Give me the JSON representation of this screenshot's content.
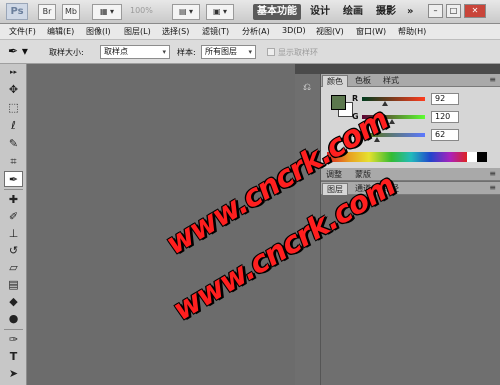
{
  "titlebar": {
    "logo": "Ps",
    "br_label": "Br",
    "mb_label": "Mb",
    "zoom": "100%",
    "workspaces": [
      "基本功能",
      "设计",
      "绘画",
      "摄影"
    ],
    "overflow": "»"
  },
  "menubar": {
    "items": [
      "文件(F)",
      "编辑(E)",
      "图像(I)",
      "图层(L)",
      "选择(S)",
      "滤镜(T)",
      "分析(A)",
      "3D(D)",
      "视图(V)",
      "窗口(W)",
      "帮助(H)"
    ]
  },
  "options": {
    "sample_size_label": "取样大小:",
    "sample_size_value": "取样点",
    "sample_label": "样本:",
    "sample_value": "所有图层",
    "show_ring_label": "显示取样环"
  },
  "color_panel": {
    "tabs": [
      "颜色",
      "色板",
      "样式"
    ],
    "channels": [
      {
        "label": "R",
        "value": "92",
        "fraction": 0.36,
        "from": "#003c1e",
        "to": "#ff3c1e"
      },
      {
        "label": "G",
        "value": "120",
        "fraction": 0.47,
        "from": "#5c0032",
        "to": "#5cff32"
      },
      {
        "label": "B",
        "value": "62",
        "fraction": 0.24,
        "from": "#5c7800",
        "to": "#5c78ff"
      }
    ],
    "foreground": "#5c784e",
    "background": "#ffffff"
  },
  "adjust_panel": {
    "tabs": [
      "调整",
      "蒙版"
    ]
  },
  "layers_panel": {
    "tabs": [
      "图层",
      "通道",
      "路径"
    ]
  },
  "watermark": {
    "text": "www.cncrk.com"
  }
}
